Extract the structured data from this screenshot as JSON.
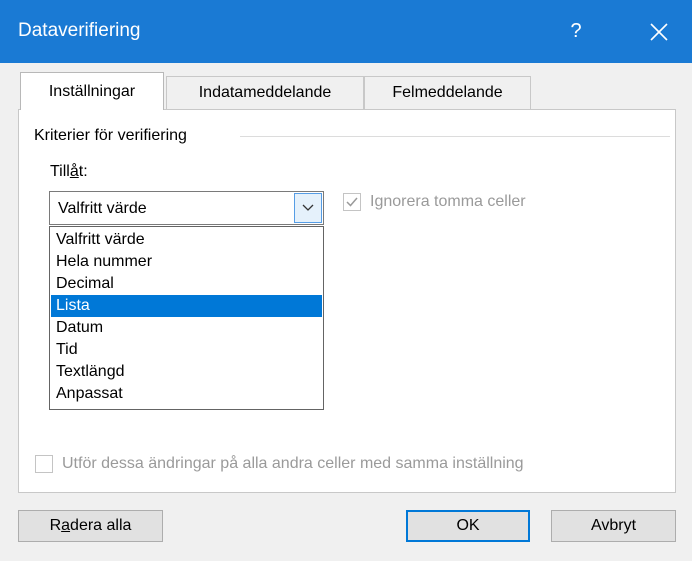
{
  "window": {
    "title": "Dataverifiering",
    "help": "?"
  },
  "tabs": [
    "Inställningar",
    "Indatameddelande",
    "Felmeddelande"
  ],
  "criteria": {
    "group_label": "Kriterier för verifiering",
    "allow_label_pre": "Till",
    "allow_label_mnemonic": "å",
    "allow_label_post": "t:",
    "allow_value": "Valfritt värde",
    "options": [
      "Valfritt värde",
      "Hela nummer",
      "Decimal",
      "Lista",
      "Datum",
      "Tid",
      "Textlängd",
      "Anpassat"
    ],
    "selected_option": "Lista",
    "ignore_blank_label": "Ignorera tomma celler",
    "ignore_blank_checked": true
  },
  "apply_all_label": "Utför dessa ändringar på alla andra celler med samma inställning",
  "apply_all_checked": false,
  "buttons": {
    "clear_pre": "R",
    "clear_mnemonic": "a",
    "clear_post": "dera alla",
    "ok": "OK",
    "cancel": "Avbryt"
  },
  "colors": {
    "titlebar": "#1a7ad4",
    "selection": "#0078d7"
  }
}
